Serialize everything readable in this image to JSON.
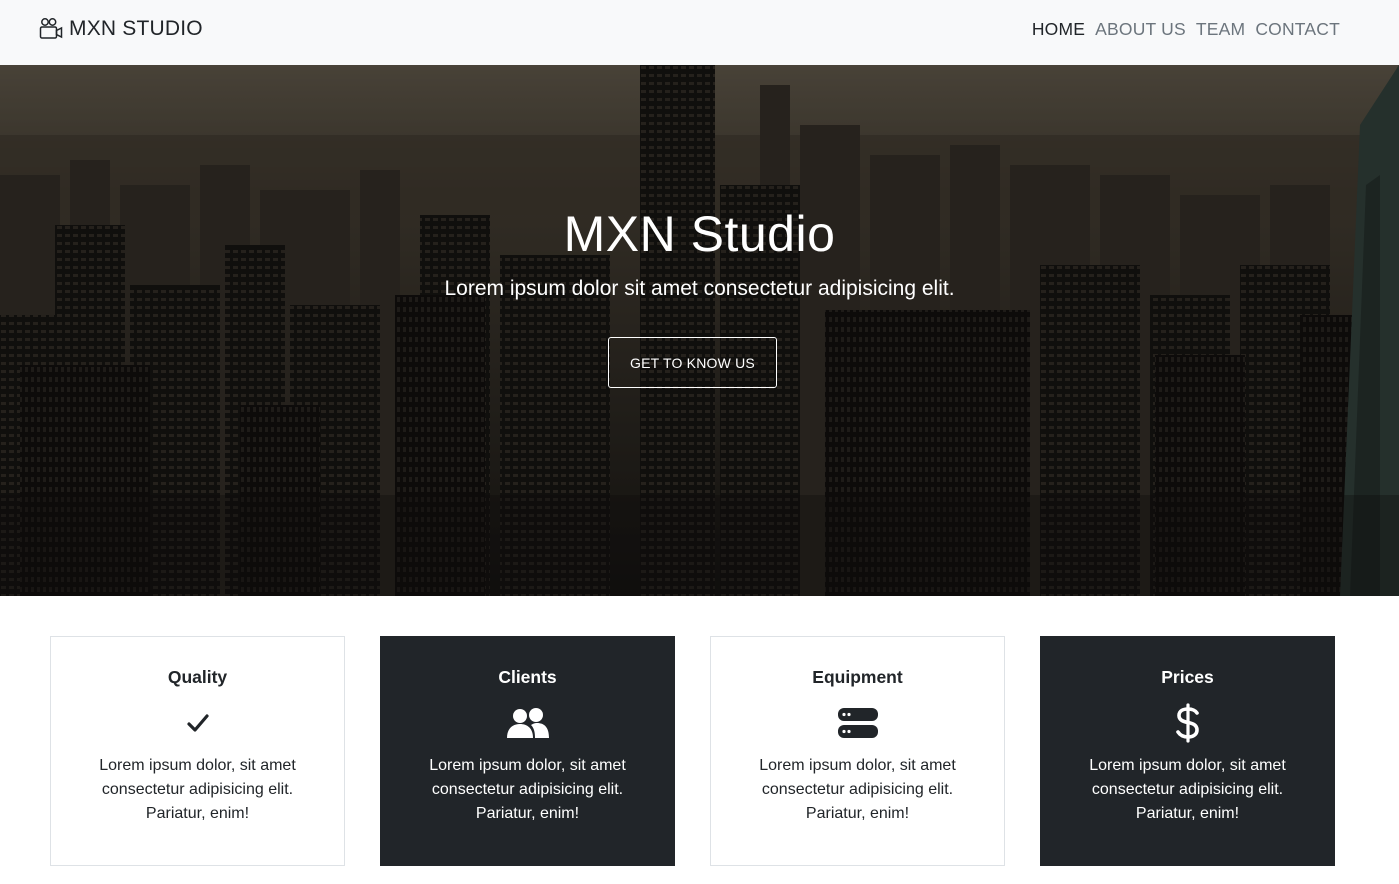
{
  "navbar": {
    "brand": "MXN STUDIO",
    "links": [
      {
        "label": "HOME",
        "active": true
      },
      {
        "label": "ABOUT US",
        "active": false
      },
      {
        "label": "TEAM",
        "active": false
      },
      {
        "label": "CONTACT",
        "active": false
      }
    ]
  },
  "hero": {
    "title": "MXN Studio",
    "subtitle": "Lorem ipsum dolor sit amet consectetur adipisicing elit.",
    "button": "GET TO KNOW US"
  },
  "features": [
    {
      "title": "Quality",
      "icon": "check-icon",
      "text": "Lorem ipsum dolor, sit amet consectetur adipisicing elit. Pariatur, enim!",
      "theme": "light"
    },
    {
      "title": "Clients",
      "icon": "users-icon",
      "text": "Lorem ipsum dolor, sit amet consectetur adipisicing elit. Pariatur, enim!",
      "theme": "dark"
    },
    {
      "title": "Equipment",
      "icon": "server-icon",
      "text": "Lorem ipsum dolor, sit amet consectetur adipisicing elit. Pariatur, enim!",
      "theme": "light"
    },
    {
      "title": "Prices",
      "icon": "dollar-icon",
      "text": "Lorem ipsum dolor, sit amet consectetur adipisicing elit. Pariatur, enim!",
      "theme": "dark"
    }
  ],
  "colors": {
    "navbar_bg": "#f8f9fa",
    "dark": "#212529",
    "muted": "#6c757d"
  }
}
